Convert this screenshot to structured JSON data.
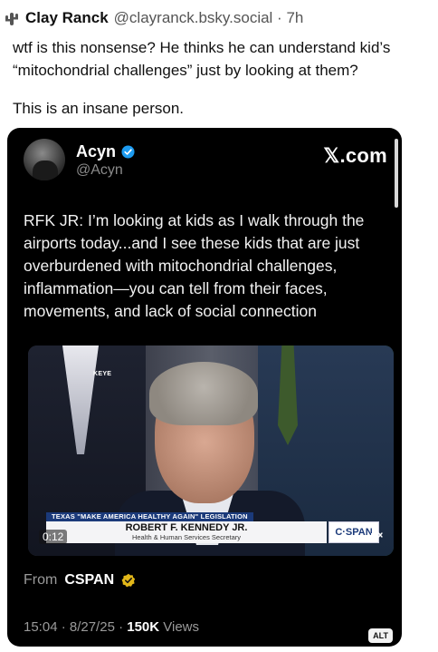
{
  "post": {
    "author_name": "Clay Ranck",
    "author_meta": "@clayranck.bsky.social · 7h",
    "text_1": "wtf is this nonsense? He thinks he can understand kid’s “mitochondrial challenges” just by looking at them?",
    "text_2": "This is an insane person."
  },
  "embed": {
    "name": "Acyn",
    "handle": "@Acyn",
    "site": "𝕏.com",
    "text": "RFK JR: I’m looking at kids as I walk through the airports today...and I see these kids that are just overburdened with mitochondrial challenges, inflammation—you can tell from their faces, movements, and lack of social connection",
    "video": {
      "watermark": "KEYE",
      "banner": "TEXAS \"MAKE AMERICA HEALTHY AGAIN\" LEGISLATION",
      "name": "ROBERT F. KENNEDY JR.",
      "title": "Health & Human Services Secretary",
      "logo": "C·SPAN",
      "time": "0:12"
    },
    "from_label": "From",
    "from_source": "CSPAN",
    "meta": "15:04 · 8/27/25 · ",
    "views_count": "150K",
    "views_label": " Views",
    "alt": "ALT"
  },
  "colors": {
    "embed_bg": "#000000",
    "verified_blue": "#1d9bf0",
    "gold_badge": "#e2b719",
    "cspan_blue": "#1b3a7a"
  }
}
